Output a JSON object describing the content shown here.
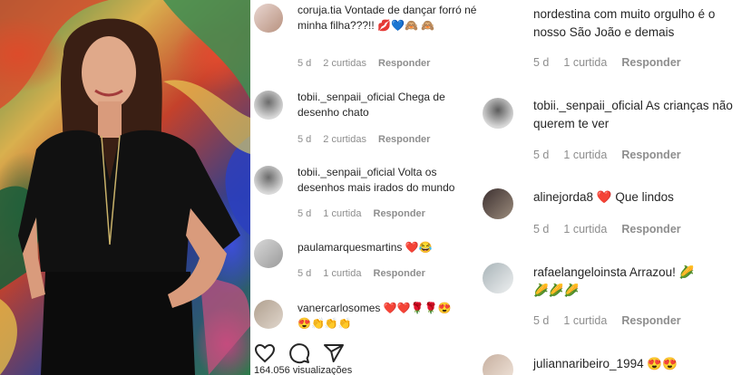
{
  "middle_comments": [
    {
      "user": "coruja.tia",
      "text": " Vontade de dançar forró né minha filha???!!",
      "emoji_line": "💋💙🙈 🙈",
      "time": "5 d",
      "likes": "2 curtidas",
      "reply": "Responder"
    },
    {
      "user": "tobii._senpaii_oficial",
      "text": " Chega de desenho chato",
      "time": "5 d",
      "likes": "2 curtidas",
      "reply": "Responder"
    },
    {
      "user": "tobii._senpaii_oficial",
      "text": " Volta os desenhos mais irados do mundo",
      "time": "5 d",
      "likes": "1 curtida",
      "reply": "Responder"
    },
    {
      "user": "paulamarquesmartins",
      "text": " ❤️😂",
      "time": "5 d",
      "likes": "1 curtida",
      "reply": "Responder"
    },
    {
      "user": "vanercarlosomes",
      "text": " ❤️❤️🌹🌹😍",
      "emoji_line": "😍👏👏👏",
      "time": "",
      "likes": "",
      "reply": ""
    }
  ],
  "right_comments": [
    {
      "user": "",
      "text": "nordestina com muito orgulho é o nosso São João e demais",
      "time": "5 d",
      "likes": "1 curtida",
      "reply": "Responder"
    },
    {
      "user": "tobii._senpaii_oficial",
      "text": " As crianças não querem te ver",
      "time": "5 d",
      "likes": "1 curtida",
      "reply": "Responder"
    },
    {
      "user": "alinejorda8",
      "text": " ❤️ Que lindos",
      "time": "5 d",
      "likes": "1 curtida",
      "reply": "Responder"
    },
    {
      "user": "rafaelangeloinsta",
      "text": " Arrazou! 🌽",
      "emoji_line": "🌽🌽🌽",
      "time": "5 d",
      "likes": "1 curtida",
      "reply": "Responder"
    },
    {
      "user": "juliannaribeiro_1994",
      "text": " 😍😍",
      "time": "",
      "likes": "",
      "reply": ""
    }
  ],
  "action_bar": {
    "likes_text": "164.056 visualizações",
    "icons": [
      "heart-icon",
      "comment-icon",
      "share-icon"
    ]
  },
  "colors": {
    "text": "#262626",
    "meta": "#8e8e8e",
    "background": "#ffffff"
  }
}
